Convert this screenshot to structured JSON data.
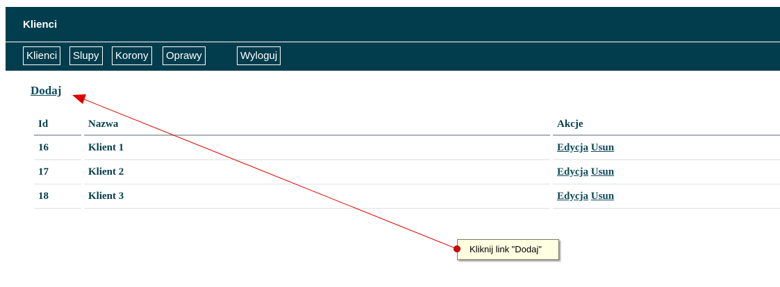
{
  "header": {
    "title": "Klienci"
  },
  "nav": {
    "items": [
      {
        "label": "Klienci"
      },
      {
        "label": "Slupy"
      },
      {
        "label": "Korony"
      },
      {
        "label": "Oprawy"
      },
      {
        "label": "Wyloguj"
      }
    ]
  },
  "main": {
    "add_label": "Dodaj",
    "table": {
      "columns": [
        "Id",
        "Nazwa",
        "Akcje"
      ],
      "rows": [
        {
          "id": "16",
          "name": "Klient 1",
          "edit": "Edycja",
          "delete": "Usun"
        },
        {
          "id": "17",
          "name": "Klient 2",
          "edit": "Edycja",
          "delete": "Usun"
        },
        {
          "id": "18",
          "name": "Klient 3",
          "edit": "Edycja",
          "delete": "Usun"
        }
      ]
    }
  },
  "callout": {
    "text": "Kliknij link \"Dodaj\""
  },
  "colors": {
    "header_bg": "#023d4d",
    "link": "#0b4a5a",
    "arrow": "#e00000",
    "tooltip_bg": "#ffffe1"
  }
}
